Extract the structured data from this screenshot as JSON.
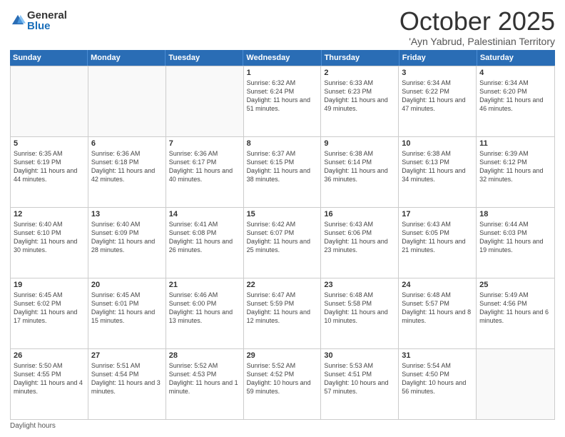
{
  "logo": {
    "general": "General",
    "blue": "Blue"
  },
  "title": "October 2025",
  "subtitle": "'Ayn Yabrud, Palestinian Territory",
  "days": [
    "Sunday",
    "Monday",
    "Tuesday",
    "Wednesday",
    "Thursday",
    "Friday",
    "Saturday"
  ],
  "footer": "Daylight hours",
  "weeks": [
    [
      {
        "day": "",
        "info": ""
      },
      {
        "day": "",
        "info": ""
      },
      {
        "day": "",
        "info": ""
      },
      {
        "day": "1",
        "info": "Sunrise: 6:32 AM\nSunset: 6:24 PM\nDaylight: 11 hours and 51 minutes."
      },
      {
        "day": "2",
        "info": "Sunrise: 6:33 AM\nSunset: 6:23 PM\nDaylight: 11 hours and 49 minutes."
      },
      {
        "day": "3",
        "info": "Sunrise: 6:34 AM\nSunset: 6:22 PM\nDaylight: 11 hours and 47 minutes."
      },
      {
        "day": "4",
        "info": "Sunrise: 6:34 AM\nSunset: 6:20 PM\nDaylight: 11 hours and 46 minutes."
      }
    ],
    [
      {
        "day": "5",
        "info": "Sunrise: 6:35 AM\nSunset: 6:19 PM\nDaylight: 11 hours and 44 minutes."
      },
      {
        "day": "6",
        "info": "Sunrise: 6:36 AM\nSunset: 6:18 PM\nDaylight: 11 hours and 42 minutes."
      },
      {
        "day": "7",
        "info": "Sunrise: 6:36 AM\nSunset: 6:17 PM\nDaylight: 11 hours and 40 minutes."
      },
      {
        "day": "8",
        "info": "Sunrise: 6:37 AM\nSunset: 6:15 PM\nDaylight: 11 hours and 38 minutes."
      },
      {
        "day": "9",
        "info": "Sunrise: 6:38 AM\nSunset: 6:14 PM\nDaylight: 11 hours and 36 minutes."
      },
      {
        "day": "10",
        "info": "Sunrise: 6:38 AM\nSunset: 6:13 PM\nDaylight: 11 hours and 34 minutes."
      },
      {
        "day": "11",
        "info": "Sunrise: 6:39 AM\nSunset: 6:12 PM\nDaylight: 11 hours and 32 minutes."
      }
    ],
    [
      {
        "day": "12",
        "info": "Sunrise: 6:40 AM\nSunset: 6:10 PM\nDaylight: 11 hours and 30 minutes."
      },
      {
        "day": "13",
        "info": "Sunrise: 6:40 AM\nSunset: 6:09 PM\nDaylight: 11 hours and 28 minutes."
      },
      {
        "day": "14",
        "info": "Sunrise: 6:41 AM\nSunset: 6:08 PM\nDaylight: 11 hours and 26 minutes."
      },
      {
        "day": "15",
        "info": "Sunrise: 6:42 AM\nSunset: 6:07 PM\nDaylight: 11 hours and 25 minutes."
      },
      {
        "day": "16",
        "info": "Sunrise: 6:43 AM\nSunset: 6:06 PM\nDaylight: 11 hours and 23 minutes."
      },
      {
        "day": "17",
        "info": "Sunrise: 6:43 AM\nSunset: 6:05 PM\nDaylight: 11 hours and 21 minutes."
      },
      {
        "day": "18",
        "info": "Sunrise: 6:44 AM\nSunset: 6:03 PM\nDaylight: 11 hours and 19 minutes."
      }
    ],
    [
      {
        "day": "19",
        "info": "Sunrise: 6:45 AM\nSunset: 6:02 PM\nDaylight: 11 hours and 17 minutes."
      },
      {
        "day": "20",
        "info": "Sunrise: 6:45 AM\nSunset: 6:01 PM\nDaylight: 11 hours and 15 minutes."
      },
      {
        "day": "21",
        "info": "Sunrise: 6:46 AM\nSunset: 6:00 PM\nDaylight: 11 hours and 13 minutes."
      },
      {
        "day": "22",
        "info": "Sunrise: 6:47 AM\nSunset: 5:59 PM\nDaylight: 11 hours and 12 minutes."
      },
      {
        "day": "23",
        "info": "Sunrise: 6:48 AM\nSunset: 5:58 PM\nDaylight: 11 hours and 10 minutes."
      },
      {
        "day": "24",
        "info": "Sunrise: 6:48 AM\nSunset: 5:57 PM\nDaylight: 11 hours and 8 minutes."
      },
      {
        "day": "25",
        "info": "Sunrise: 5:49 AM\nSunset: 4:56 PM\nDaylight: 11 hours and 6 minutes."
      }
    ],
    [
      {
        "day": "26",
        "info": "Sunrise: 5:50 AM\nSunset: 4:55 PM\nDaylight: 11 hours and 4 minutes."
      },
      {
        "day": "27",
        "info": "Sunrise: 5:51 AM\nSunset: 4:54 PM\nDaylight: 11 hours and 3 minutes."
      },
      {
        "day": "28",
        "info": "Sunrise: 5:52 AM\nSunset: 4:53 PM\nDaylight: 11 hours and 1 minute."
      },
      {
        "day": "29",
        "info": "Sunrise: 5:52 AM\nSunset: 4:52 PM\nDaylight: 10 hours and 59 minutes."
      },
      {
        "day": "30",
        "info": "Sunrise: 5:53 AM\nSunset: 4:51 PM\nDaylight: 10 hours and 57 minutes."
      },
      {
        "day": "31",
        "info": "Sunrise: 5:54 AM\nSunset: 4:50 PM\nDaylight: 10 hours and 56 minutes."
      },
      {
        "day": "",
        "info": ""
      }
    ]
  ]
}
